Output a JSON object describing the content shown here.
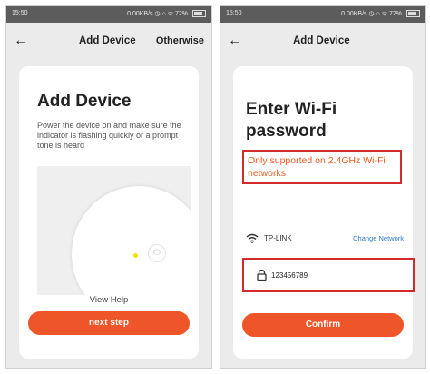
{
  "left_screen": {
    "status": {
      "time": "15:50",
      "right": "0.00KB/s ◷ ⌂ ᯤ 72%"
    },
    "nav": {
      "back": "←",
      "title": "Add Device",
      "action": "Otherwise"
    },
    "heading": "Add Device",
    "description": "Power the device on and make sure the indicator is flashing quickly or a prompt tone is heard",
    "illustration": {
      "power_icon": "⏻"
    },
    "view_help": "View Help",
    "button": "next step"
  },
  "right_screen": {
    "status": {
      "time": "15:50",
      "right": "0.00KB/s ◷ ⌂ ᯤ 72%"
    },
    "nav": {
      "back": "←",
      "title": "Add Device"
    },
    "heading_line1": "Enter Wi-Fi",
    "heading_line2": "password",
    "warning": "Only supported on 2.4GHz Wi-Fi networks",
    "wifi": {
      "ssid": "TP-LINK",
      "change": "Change Network"
    },
    "password": {
      "value": "123456789"
    },
    "button": "Confirm"
  },
  "colors": {
    "accent": "#ee5529",
    "highlight_border": "#d42a2a",
    "link": "#2e7ac9",
    "warning_text": "#ee5a20"
  },
  "icons": [
    "back-arrow-icon",
    "battery-icon",
    "power-icon",
    "wifi-icon",
    "lock-icon"
  ]
}
